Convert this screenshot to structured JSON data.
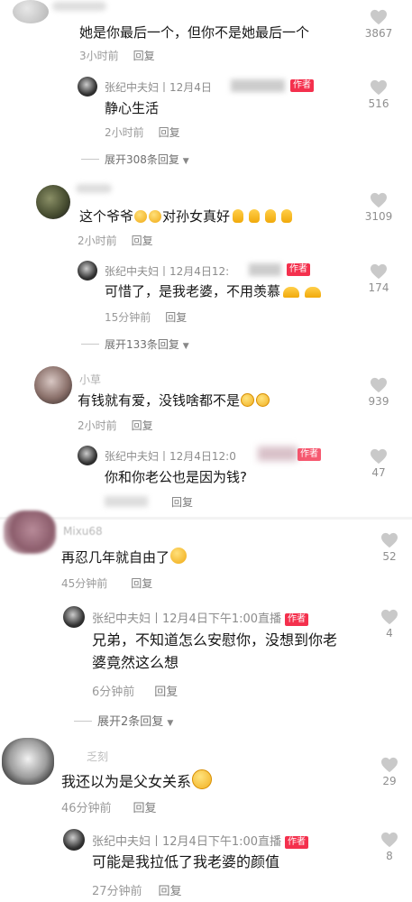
{
  "comments": [
    {
      "text": "她是你最后一个，但你不是她最后一个",
      "time": "3小时前",
      "reply": "回复",
      "likes": "3867",
      "author_reply": {
        "name": "张纪中夫妇丨12月4日",
        "tag": "作者",
        "text": "静心生活",
        "time": "2小时前",
        "reply": "回复",
        "likes": "516"
      },
      "expand": "展开308条回复"
    },
    {
      "text": "这个爷爷",
      "text2": "对孙女真好",
      "time": "2小时前",
      "reply": "回复",
      "likes": "3109",
      "author_reply": {
        "name": "张纪中夫妇丨12月4日12:",
        "tag": "作者",
        "text": "可惜了，是我老婆，不用羡慕",
        "time": "15分钟前",
        "reply": "回复",
        "likes": "174"
      },
      "expand": "展开133条回复"
    },
    {
      "username": "小草",
      "text": "有钱就有爱，没钱啥都不是",
      "time": "2小时前",
      "reply": "回复",
      "likes": "939",
      "author_reply": {
        "name": "张纪中夫妇丨12月4日12:0",
        "tag": "作者",
        "text": "你和你老公也是因为钱?",
        "time": "",
        "reply": "回复",
        "likes": "47"
      }
    },
    {
      "username": "Mixu68",
      "text": "再忍几年就自由了",
      "time": "45分钟前",
      "reply": "回复",
      "likes": "52",
      "author_reply": {
        "name": "张纪中夫妇丨12月4日下午1:00直播",
        "tag": "作者",
        "text": "兄弟，不知道怎么安慰你，没想到你老",
        "text2": "婆竟然这么想",
        "time": "6分钟前",
        "reply": "回复",
        "likes": "4"
      },
      "expand": "展开2条回复"
    },
    {
      "username": "乏刻",
      "text": "我还以为是父女关系",
      "time": "46分钟前",
      "reply": "回复",
      "likes": "29",
      "author_reply": {
        "name": "张纪中夫妇丨12月4日下午1:00直播",
        "tag": "作者",
        "text": "可能是我拉低了我老婆的颜值",
        "time": "27分钟前",
        "reply": "回复",
        "likes": "8"
      }
    }
  ],
  "icons": {
    "like": "heart-icon",
    "expand": "chevron-down-icon"
  },
  "colors": {
    "tag": "#f4304d",
    "meta": "#9a9a9a",
    "heart": "#c9c9c9"
  }
}
